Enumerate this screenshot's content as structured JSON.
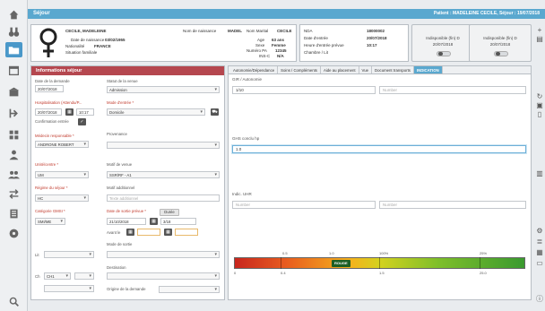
{
  "topbar": {
    "title": "Séjour",
    "patient": "Patient : MADELEINE CECILE, Séjour : 19/07/2018"
  },
  "sidebar": {
    "items": [
      "home-icon",
      "binoculars-icon",
      "folder-icon",
      "calendar-icon",
      "building-icon",
      "transfer-icon",
      "grid-icon",
      "person-icon",
      "group-icon",
      "arrows-icon",
      "register-icon",
      "disc-icon",
      "search-icon"
    ]
  },
  "patient": {
    "name": "CECILE, MADELEINE",
    "birth_label": "Date de naissance",
    "birth_date": "03/02/1955",
    "nationality_label": "Nationalité",
    "nationality": "FRANCE",
    "situation": "Situation familiale",
    "birth_name_label": "Nom de naissance",
    "birth_name": "MADEL",
    "first_name_label": "Nom Marital",
    "first_name": "CECILE",
    "age_label": "Age",
    "age": "63 ans",
    "gender_label": "Sexe",
    "gender": "Femme",
    "number_label": "Numéro PA",
    "number": "12345",
    "ins_label": "INS-C",
    "ins": "N/A"
  },
  "stay": {
    "nda_label": "NDA",
    "nda": "18000002",
    "entry_date_label": "Date d'entrée",
    "entry_date": "20/07/2018",
    "entry_time_label": "Heure d'entrée prévue",
    "entry_time": "10:17",
    "chamber_label": "Chambre / Lit",
    "chamber": ""
  },
  "toggles": [
    {
      "label": "Indisponible (fin) D",
      "date": "20/07/2018"
    },
    {
      "label": "Indisponible (fin) D",
      "date": "20/07/2018"
    }
  ],
  "info": {
    "header": "Informations séjour",
    "date_demande_label": "Date de la demande",
    "date_demande": "20/07/2018",
    "hospit_label": "Hospitalisation (Attendu/P...",
    "hospit_date": "20/07/2018",
    "hospit_time": "10:17",
    "confirm_label": "Confirmation entrée",
    "medecin_label": "Médecin responsable *",
    "medecin": "ANDRONE ROBERT",
    "statut_label": "Statut de la venue",
    "statut": "Admission",
    "mode_label": "Mode d'entrée *",
    "mode": "Domicile",
    "provenance_label": "Provenance",
    "provenance": "",
    "unite_label": "Unité/centre *",
    "unite": "UM",
    "regime_label": "Régime du séjour *",
    "regime": "HC",
    "motif_label": "Motif de venue",
    "motif": "SSR/RF - A1",
    "categorie_label": "Catégorie GMSI *",
    "categorie": "SMI/ME",
    "motif_add_label": "Motif additionnel",
    "motif_add_ph": "Texte additionnel",
    "date_sortie_label": "Date de sortie prévue *",
    "date_sortie": "21/10/2018",
    "duree_btn": "Durée",
    "duree_val": "3/18",
    "avant_label": "Avant le",
    "mode_sortie_label": "Mode de sortie",
    "destination_label": "Destination",
    "origine_label": "Origine de la demande",
    "lit_label": "Lit",
    "chambre_label": "Ch",
    "chambre_val": "CH1"
  },
  "tabs": {
    "items": [
      "Autonomie/Dépendance",
      "Soins / Compléments",
      "Aide au placement",
      "Vue",
      "Document transports",
      "INDICATION"
    ],
    "active_index": 5,
    "gir_label": "GIR / Autonomie",
    "gir_value": "1/10",
    "gir_ph": "Number",
    "barthel_label": "GHS conclu hp",
    "barthel_value": "1.0",
    "note_label": "Indic. UHR",
    "note_ph_1": "Number",
    "note_ph_2": "Number",
    "scale_ticks_top": [
      "0.5",
      "1.0",
      "100%",
      "25%"
    ],
    "scale_ticks_bottom": [
      "0",
      "0.4",
      "1.5",
      "25.0"
    ],
    "scale_marker": "ROUGE"
  }
}
